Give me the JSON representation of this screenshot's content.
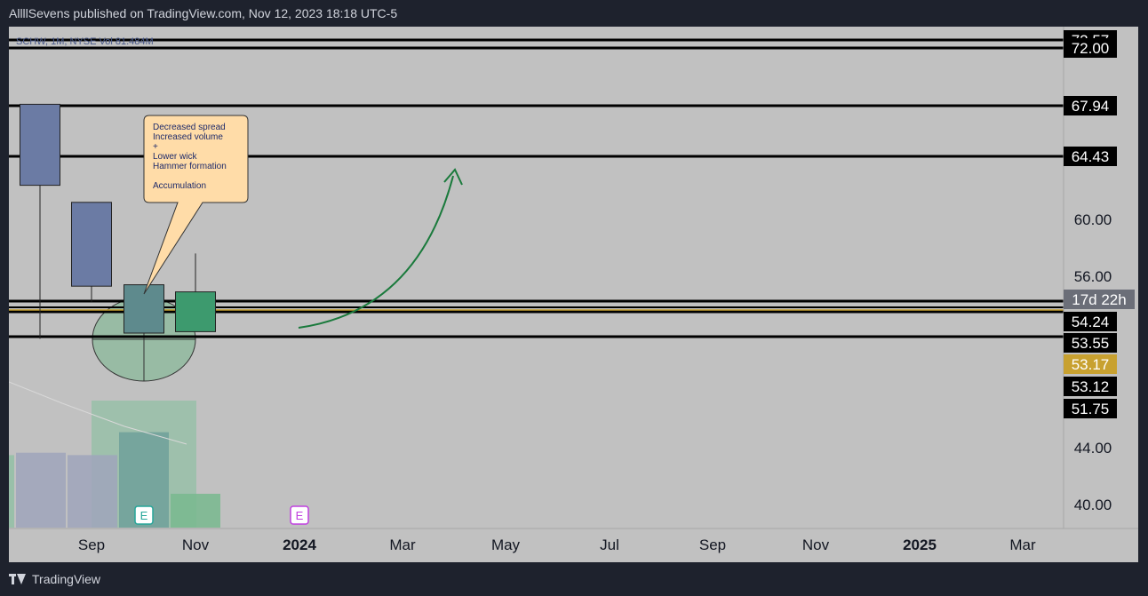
{
  "header": {
    "published_by": "AllllSevens published on TradingView.com, Nov 12, 2023 18:18 UTC-5"
  },
  "footer": {
    "brand": "TradingView"
  },
  "chart_data": {
    "type": "candlestick",
    "legend_text": "SCHW, 1M, NYSE  Vol 81.484M",
    "y_axis_ticks": [
      "60.00",
      "56.00",
      "44.00",
      "40.00"
    ],
    "x_axis_ticks": [
      "Sep",
      "Nov",
      "2024",
      "Mar",
      "May",
      "Jul",
      "Sep",
      "Nov",
      "2025",
      "Mar"
    ],
    "x_axis_bold": [
      "2024",
      "2025"
    ],
    "candles": [
      {
        "open": 62.4,
        "high": 68.1,
        "low": 51.6,
        "close": 68.1,
        "color": "#6b7ba4"
      },
      {
        "open": 61.2,
        "high": 61.2,
        "low": 54.2,
        "close": 55.3,
        "color": "#6b7ba4"
      },
      {
        "open": 55.4,
        "high": 55.4,
        "low": 52.0,
        "close": 52.0,
        "color": "#5e8a8d"
      },
      {
        "open": 52.1,
        "high": 57.6,
        "low": 52.1,
        "close": 54.9,
        "color": "#3d9a6e"
      }
    ],
    "volume_bars": [
      {
        "value": 62,
        "color": "#9fa5bb"
      },
      {
        "value": 60,
        "color": "#9fa5bb"
      },
      {
        "value": 79,
        "color": "#6fa09a"
      },
      {
        "value": 28,
        "color": "#78b88e"
      }
    ],
    "horizontal_levels": [
      {
        "label": "72.57",
        "style": "black"
      },
      {
        "label": "72.00",
        "style": "black"
      },
      {
        "label": "67.94",
        "style": "black"
      },
      {
        "label": "64.43",
        "style": "black"
      },
      {
        "label": "17d 22h",
        "style": "grey"
      },
      {
        "label": "54.24",
        "style": "black"
      },
      {
        "label": "53.55",
        "style": "black"
      },
      {
        "label": "53.17",
        "style": "gold"
      },
      {
        "label": "53.12",
        "style": "black"
      },
      {
        "label": "51.75",
        "style": "black"
      }
    ],
    "callout": {
      "lines": [
        "Decreased spread",
        "Increased volume",
        "+",
        "Lower wick",
        "Hammer formation",
        "",
        "Accumulation"
      ]
    },
    "earnings_markers": [
      {
        "label": "E",
        "color": "#26a69a"
      },
      {
        "label": "E",
        "color": "#c040e0"
      }
    ],
    "colors": {
      "plot_bg": "#c1c1c1",
      "axis_text": "#131722",
      "arrow": "#1a7a3c",
      "level_line": "#000000",
      "gold_line": "#c8a130",
      "callout_bg": "#ffdca8"
    }
  }
}
